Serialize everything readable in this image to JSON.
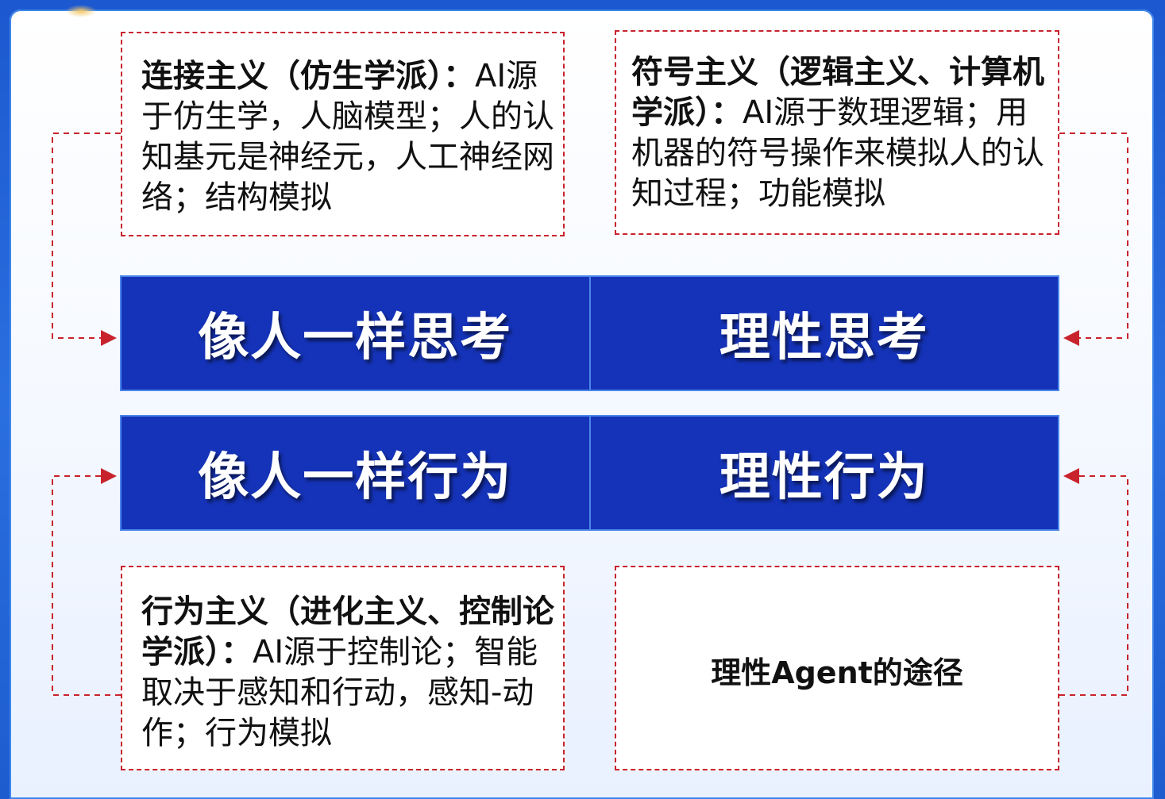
{
  "connectionism": {
    "bold": "连接主义（仿生学派）：",
    "text": "AI源于仿生学，人脑模型；人的认知基元是神经元，人工神经网络；结构模拟"
  },
  "symbolism": {
    "bold": "符号主义（逻辑主义、计算机学派）：",
    "text": "AI源于数理逻辑；用机器的符号操作来模拟人的认知过程；功能模拟"
  },
  "behaviorism": {
    "bold": "行为主义（进化主义、控制论学派）：",
    "text": "AI源于控制论；智能取决于感知和行动，感知-动作；行为模拟"
  },
  "rational_agent": {
    "label": "理性Agent的途径"
  },
  "grid": {
    "think_human": "像人一样思考",
    "think_rational": "理性思考",
    "act_human": "像人一样行为",
    "act_rational": "理性行为"
  },
  "colors": {
    "cell_fill": "#1533b8",
    "dashed_border": "#c8232c",
    "arrow": "#c8232c"
  }
}
